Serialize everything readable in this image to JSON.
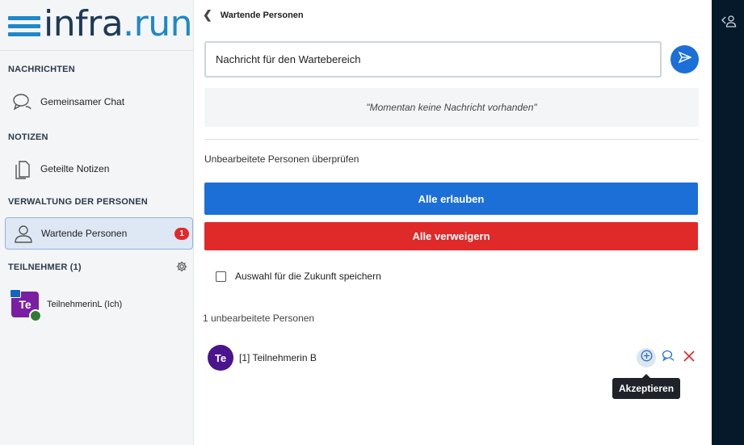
{
  "logo": {
    "part1": "infra",
    "dot": ".",
    "part2": "run"
  },
  "sidebar": {
    "messages_section": "NACHRICHTEN",
    "chat_label": "Gemeinsamer Chat",
    "notes_section": "NOTIZEN",
    "notes_label": "Geteilte Notizen",
    "management_section": "VERWALTUNG DER PERSONEN",
    "waiting_label": "Wartende Personen",
    "waiting_badge": "1",
    "participants_section": "TEILNEHMER (1)",
    "participant": {
      "initials": "Te",
      "name": "TeilnehmerinL (Ich)"
    }
  },
  "main": {
    "back_label": "Wartende Personen",
    "message_placeholder": "Nachricht für den Wartebereich",
    "empty_message": "\"Momentan keine Nachricht vorhanden\"",
    "review_label": "Unbearbeitete Personen überprüfen",
    "allow_all": "Alle erlauben",
    "deny_all": "Alle verweigern",
    "remember_choice": "Auswahl für die Zukunft speichern",
    "pending_count": "1 unbearbeitete Personen",
    "person": {
      "initials": "Te",
      "name": "[1] Teilnehmerin B"
    },
    "tooltip": "Akzeptieren"
  },
  "colors": {
    "primary": "#1c6fd6",
    "danger": "#e02929",
    "avatar": "#4a148c",
    "dark_strip": "#06192b"
  }
}
